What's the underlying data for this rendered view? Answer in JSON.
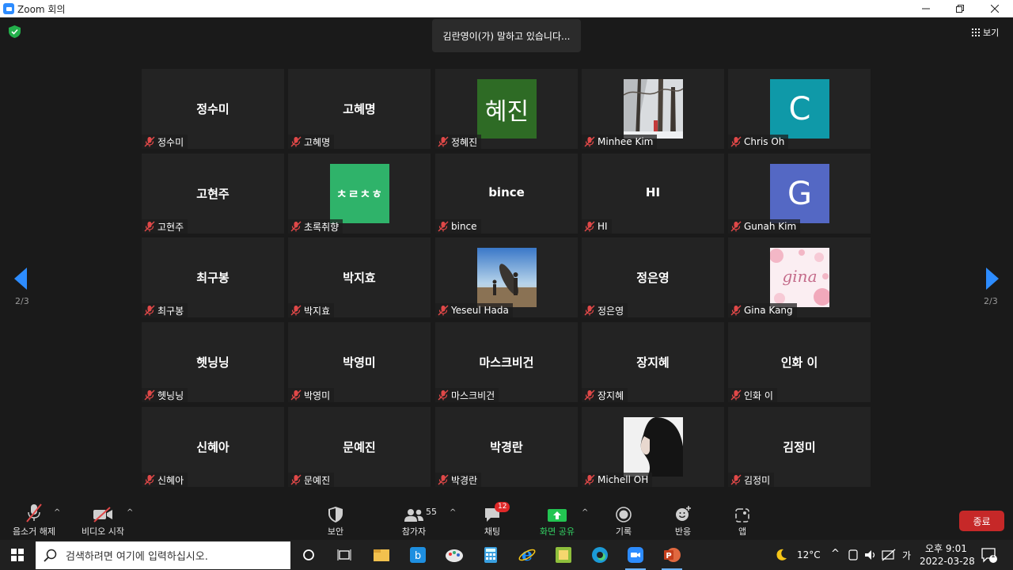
{
  "window": {
    "title": "Zoom 회의"
  },
  "banner": {
    "speaking": "김란영이(가) 말하고 있습니다..."
  },
  "view": {
    "label": "보기"
  },
  "pagination": {
    "left": "2/3",
    "right": "2/3"
  },
  "tiles": [
    {
      "display": "정수미",
      "label": "정수미",
      "avatar": "none"
    },
    {
      "display": "고혜명",
      "label": "고혜명",
      "avatar": "none"
    },
    {
      "display": "",
      "label": "정혜진",
      "avatar": "text",
      "avatar_text": "혜진",
      "avatar_color": "#2e6b25"
    },
    {
      "display": "",
      "label": "Minhee Kim",
      "avatar": "photo-snow"
    },
    {
      "display": "",
      "label": "Chris Oh",
      "avatar": "text",
      "avatar_text": "C",
      "avatar_color": "#0f99a8"
    },
    {
      "display": "고현주",
      "label": "고현주",
      "avatar": "none"
    },
    {
      "display": "",
      "label": "초록취향",
      "avatar": "text",
      "avatar_text": "ㅊㄹㅊㅎ",
      "avatar_color": "#2fb36a"
    },
    {
      "display": "bince",
      "label": "bince",
      "avatar": "none"
    },
    {
      "display": "HI",
      "label": "HI",
      "avatar": "none"
    },
    {
      "display": "",
      "label": "Gunah Kim",
      "avatar": "text",
      "avatar_text": "G",
      "avatar_color": "#5468c4"
    },
    {
      "display": "최구봉",
      "label": "최구봉",
      "avatar": "none"
    },
    {
      "display": "박지효",
      "label": "박지효",
      "avatar": "none"
    },
    {
      "display": "",
      "label": "Yeseul Hada",
      "avatar": "photo-beach"
    },
    {
      "display": "정은영",
      "label": "정은영",
      "avatar": "none"
    },
    {
      "display": "",
      "label": "Gina Kang",
      "avatar": "photo-gina",
      "avatar_text": "gina"
    },
    {
      "display": "헷닝닝",
      "label": "헷닝닝",
      "avatar": "none"
    },
    {
      "display": "박영미",
      "label": "박영미",
      "avatar": "none"
    },
    {
      "display": "마스크비건",
      "label": "마스크비건",
      "avatar": "none"
    },
    {
      "display": "장지혜",
      "label": "장지혜",
      "avatar": "none"
    },
    {
      "display": "인화 이",
      "label": "인화 이",
      "avatar": "none"
    },
    {
      "display": "신혜아",
      "label": "신혜아",
      "avatar": "none"
    },
    {
      "display": "문예진",
      "label": "문예진",
      "avatar": "none"
    },
    {
      "display": "박경란",
      "label": "박경란",
      "avatar": "none"
    },
    {
      "display": "",
      "label": "Michell OH",
      "avatar": "photo-portrait"
    },
    {
      "display": "김정미",
      "label": "김정미",
      "avatar": "none"
    }
  ],
  "toolbar": {
    "unmute": "음소거 해제",
    "video": "비디오 시작",
    "security": "보안",
    "participants": "참가자",
    "participants_count": "55",
    "chat": "채팅",
    "chat_badge": "12",
    "share": "화면 공유",
    "record": "기록",
    "reactions": "반응",
    "apps": "앱",
    "end": "종료"
  },
  "taskbar": {
    "search_placeholder": "검색하려면 여기에 입력하십시오.",
    "weather": "12°C",
    "ime": "가",
    "time": "오후 9:01",
    "date": "2022-03-28",
    "notifications": "1"
  },
  "colors": {
    "accent_green": "#33d163",
    "end_red": "#c62828",
    "mute_red": "#e04848"
  }
}
